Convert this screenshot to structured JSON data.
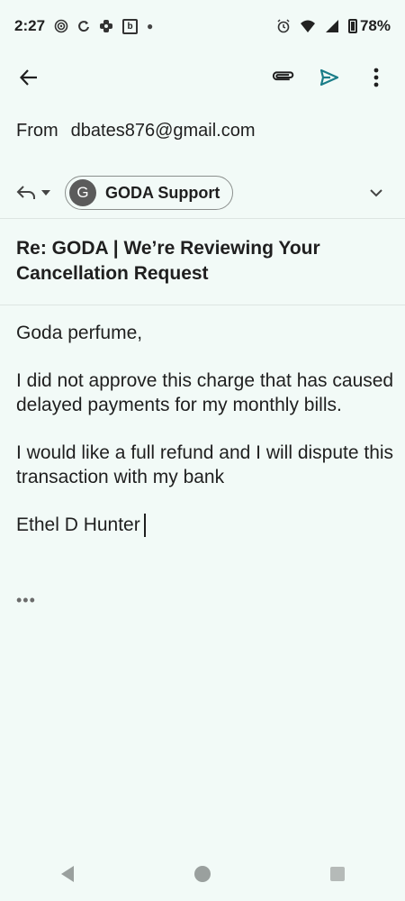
{
  "status_bar": {
    "time": "2:27",
    "battery_percent": "78%",
    "icons": [
      "gps-ring-icon",
      "sync-icon",
      "gear-flower-icon",
      "b-icon",
      "dot",
      "alarm-icon",
      "wifi-icon",
      "signal-icon",
      "battery-icon"
    ],
    "b_label": "b"
  },
  "toolbar": {
    "back_icon": "arrow-left-icon",
    "attach_icon": "paperclip-icon",
    "send_icon": "send-icon",
    "more_icon": "more-vert-icon",
    "accent_color": "#1a7d88"
  },
  "from": {
    "label": "From",
    "email": "dbates876@gmail.com"
  },
  "to": {
    "avatar_letter": "G",
    "name": "GODA Support"
  },
  "subject": "Re: GODA | We’re Reviewing Your Cancellation Request",
  "body": {
    "greeting": "Goda perfume,",
    "paragraph1": "I did not approve this charge that has caused delayed payments for my monthly bills.",
    "paragraph2": "I would like a full refund and I will dispute this transaction with my bank",
    "signature": "Ethel D Hunter"
  },
  "quoted_toggle": "•••"
}
